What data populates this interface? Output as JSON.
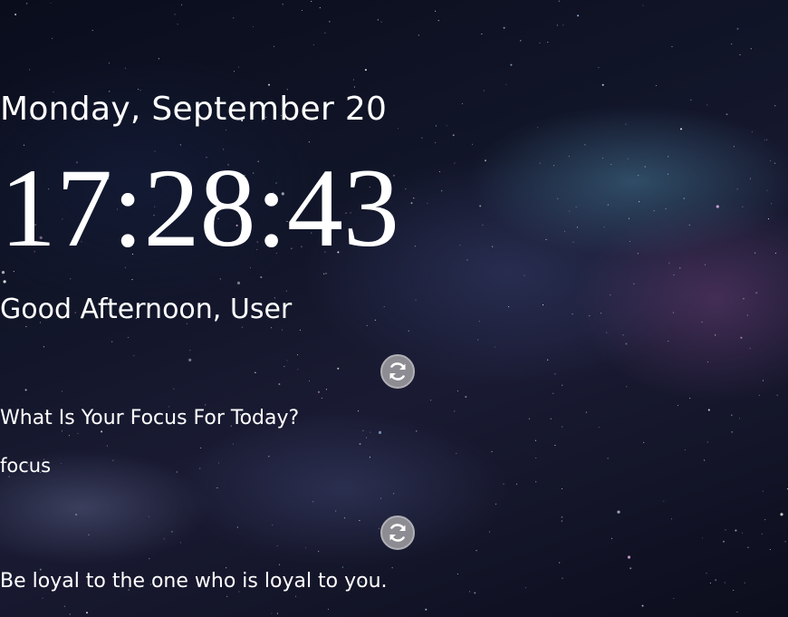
{
  "date": "Monday, September 20",
  "time": "17:28:43",
  "greeting": "Good Afternoon, User",
  "focus": {
    "question": "What Is Your Focus For Today?",
    "value": "focus",
    "refresh_icon": "refresh-icon"
  },
  "quote": {
    "text": "Be loyal to the one who is loyal to you.",
    "refresh_icon": "refresh-icon"
  },
  "colors": {
    "text": "#ffffff",
    "button_bg": "#8c8c92",
    "background": "#111528"
  }
}
